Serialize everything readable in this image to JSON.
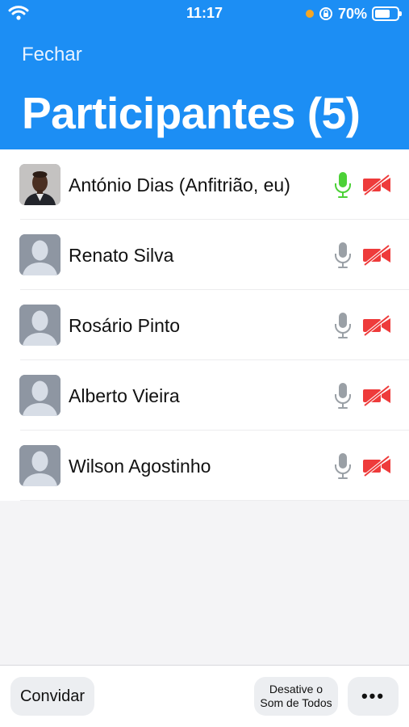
{
  "status_bar": {
    "time": "11:17",
    "battery_text": "70%",
    "battery_level": 0.7
  },
  "header": {
    "close_label": "Fechar",
    "title": "Participantes (5)"
  },
  "participants": [
    {
      "name": "António Dias (Anfitrião, eu)",
      "avatar": "photo",
      "mic": "active",
      "video": "off"
    },
    {
      "name": "Renato Silva",
      "avatar": "default",
      "mic": "idle",
      "video": "off"
    },
    {
      "name": "Rosário Pinto",
      "avatar": "default",
      "mic": "idle",
      "video": "off"
    },
    {
      "name": "Alberto Vieira",
      "avatar": "default",
      "mic": "idle",
      "video": "off"
    },
    {
      "name": "Wilson Agostinho",
      "avatar": "default",
      "mic": "idle",
      "video": "off"
    }
  ],
  "bottom_bar": {
    "invite_label": "Convidar",
    "mute_all_label": "Desative o Som de Todos",
    "more_label": "•••"
  },
  "colors": {
    "header_bg": "#1c8ef4",
    "mic_active": "#4cd137",
    "mic_idle": "#9aa0a6",
    "video_off": "#ee3b3b"
  }
}
